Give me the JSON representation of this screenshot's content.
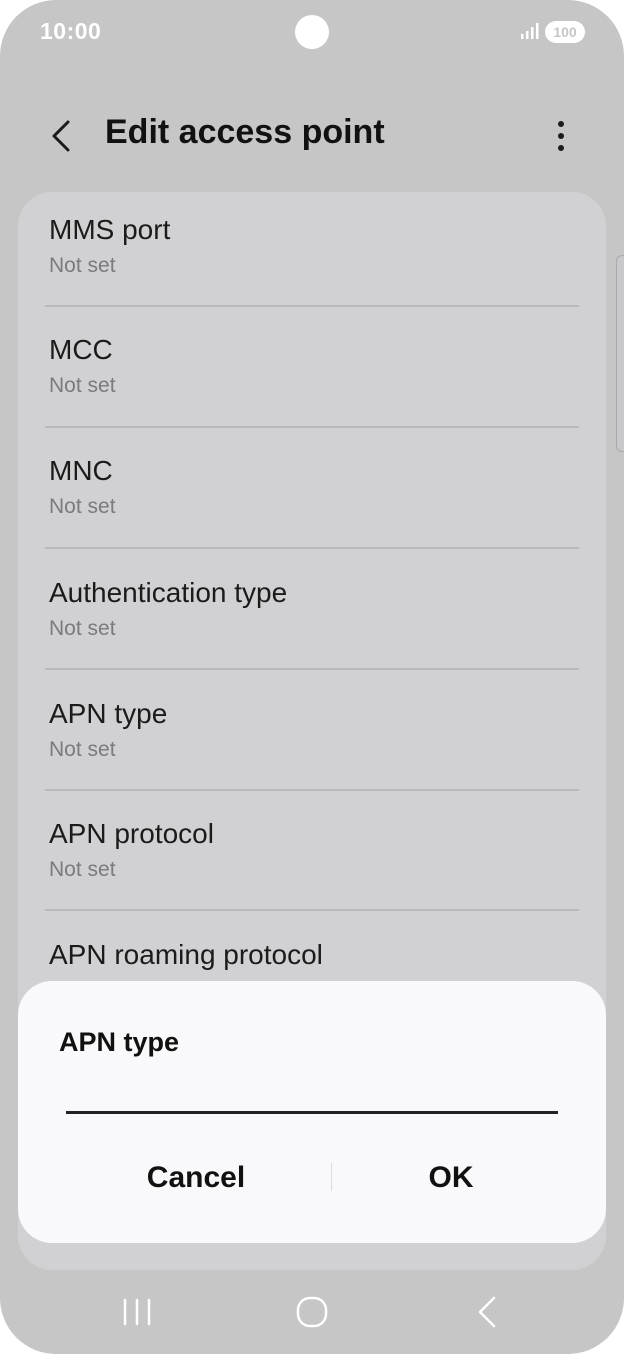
{
  "status_bar": {
    "time": "10:00",
    "battery": "100"
  },
  "app_bar": {
    "title": "Edit access point"
  },
  "settings": {
    "items": [
      {
        "title": "MMS port",
        "value": "Not set"
      },
      {
        "title": "MCC",
        "value": "Not set"
      },
      {
        "title": "MNC",
        "value": "Not set"
      },
      {
        "title": "Authentication type",
        "value": "Not set"
      },
      {
        "title": "APN type",
        "value": "Not set"
      },
      {
        "title": "APN protocol",
        "value": "Not set"
      },
      {
        "title": "APN roaming protocol",
        "value": ""
      }
    ]
  },
  "dialog": {
    "title": "APN type",
    "input_value": "",
    "cancel_label": "Cancel",
    "ok_label": "OK"
  },
  "icons": {
    "back": "back-arrow-icon",
    "more": "more-vertical-icon",
    "signal": "signal-icon",
    "nav_recents": "recents-icon",
    "nav_home": "home-icon",
    "nav_back": "nav-back-icon"
  },
  "colors": {
    "screen_dim": "#c6c6c7",
    "card": "#d1d1d3",
    "dialog": "#f9f9fb",
    "text": "#111111",
    "secondary_text": "#7b7b7d"
  }
}
